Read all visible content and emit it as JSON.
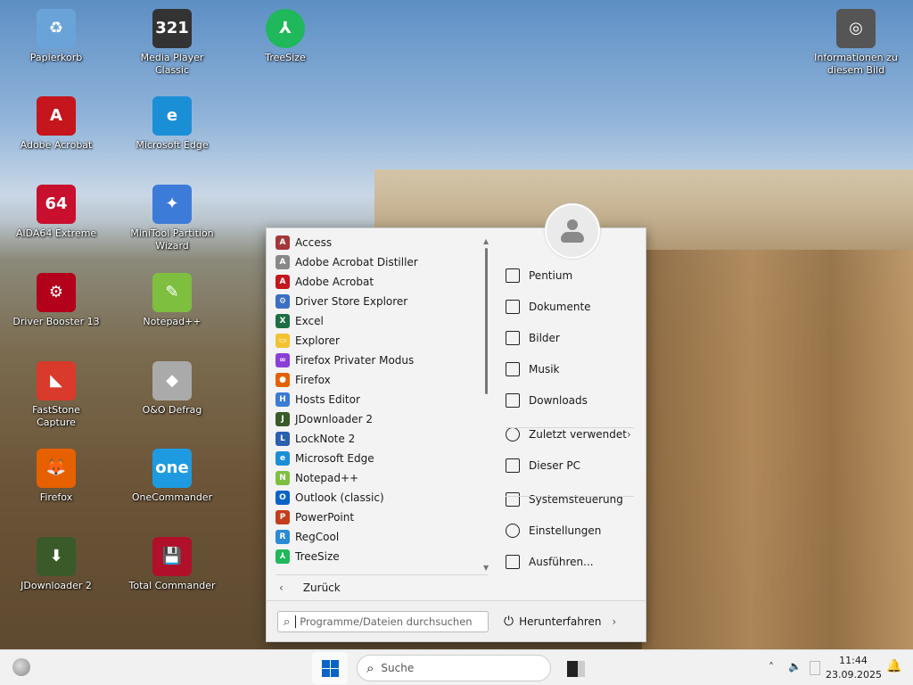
{
  "desktop": {
    "icons": [
      {
        "label": "Papierkorb",
        "glyph": "♻",
        "color": "#6aa3d8"
      },
      {
        "label": "Media Player Classic",
        "glyph": "321",
        "color": "#333"
      },
      {
        "label": "TreeSize",
        "glyph": "⅄",
        "color": "#1fb85a"
      },
      {
        "label": "Adobe Acrobat",
        "glyph": "A",
        "color": "#c4161c"
      },
      {
        "label": "Microsoft Edge",
        "glyph": "e",
        "color": "#1a8fd6"
      },
      {
        "label": "AIDA64 Extreme",
        "glyph": "64",
        "color": "#c8102e"
      },
      {
        "label": "MiniTool Partition Wizard",
        "glyph": "✦",
        "color": "#3d7bd9"
      },
      {
        "label": "Driver Booster 13",
        "glyph": "⚙",
        "color": "#b3001b"
      },
      {
        "label": "Notepad++",
        "glyph": "✎",
        "color": "#7fbf3f"
      },
      {
        "label": "FastStone Capture",
        "glyph": "◣",
        "color": "#d93a2b"
      },
      {
        "label": "O&O Defrag",
        "glyph": "◆",
        "color": "#aaa"
      },
      {
        "label": "Firefox",
        "glyph": "🦊",
        "color": "#e66000"
      },
      {
        "label": "OneCommander",
        "glyph": "one",
        "color": "#1e9be0"
      },
      {
        "label": "JDownloader 2",
        "glyph": "⬇",
        "color": "#3a5a2a"
      },
      {
        "label": "Total Commander",
        "glyph": "💾",
        "color": "#b0102a"
      },
      {
        "label": "Informationen zu diesem Bild",
        "glyph": "◎",
        "color": "#555"
      }
    ]
  },
  "start": {
    "apps": [
      {
        "label": "Access",
        "glyph": "A",
        "color": "#a4373a"
      },
      {
        "label": "Adobe Acrobat Distiller",
        "glyph": "A",
        "color": "#888"
      },
      {
        "label": "Adobe Acrobat",
        "glyph": "A",
        "color": "#c4161c"
      },
      {
        "label": "Driver Store Explorer",
        "glyph": "⚙",
        "color": "#3b6fc4"
      },
      {
        "label": "Excel",
        "glyph": "X",
        "color": "#1d6f42"
      },
      {
        "label": "Explorer",
        "glyph": "▭",
        "color": "#f2c230"
      },
      {
        "label": "Firefox Privater Modus",
        "glyph": "∞",
        "color": "#8b3fd9"
      },
      {
        "label": "Firefox",
        "glyph": "●",
        "color": "#e66000"
      },
      {
        "label": "Hosts Editor",
        "glyph": "H",
        "color": "#3a7bd5"
      },
      {
        "label": "JDownloader 2",
        "glyph": "J",
        "color": "#3a5a2a"
      },
      {
        "label": "LockNote 2",
        "glyph": "L",
        "color": "#2b5fb0"
      },
      {
        "label": "Microsoft Edge",
        "glyph": "e",
        "color": "#1a8fd6"
      },
      {
        "label": "Notepad++",
        "glyph": "N",
        "color": "#7fbf3f"
      },
      {
        "label": "Outlook (classic)",
        "glyph": "O",
        "color": "#0a64c8"
      },
      {
        "label": "PowerPoint",
        "glyph": "P",
        "color": "#c43e1c"
      },
      {
        "label": "RegCool",
        "glyph": "R",
        "color": "#2a8ad4"
      },
      {
        "label": "TreeSize",
        "glyph": "⅄",
        "color": "#1fb85a"
      }
    ],
    "back_label": "Zurück",
    "search_placeholder": "Programme/Dateien durchsuchen",
    "places": [
      {
        "label": "Pentium",
        "icon": "user-folder-icon"
      },
      {
        "label": "Dokumente",
        "icon": "document-icon"
      },
      {
        "label": "Bilder",
        "icon": "picture-icon"
      },
      {
        "label": "Musik",
        "icon": "music-icon"
      },
      {
        "label": "Downloads",
        "icon": "download-icon"
      },
      {
        "label": "Zuletzt verwendet",
        "icon": "clock-icon"
      },
      {
        "label": "Dieser PC",
        "icon": "computer-icon"
      },
      {
        "label": "Systemsteuerung",
        "icon": "control-panel-icon"
      },
      {
        "label": "Einstellungen",
        "icon": "gear-icon"
      },
      {
        "label": "Ausführen...",
        "icon": "run-icon"
      }
    ],
    "shutdown_label": "Herunterfahren"
  },
  "taskbar": {
    "search_label": "Suche",
    "time": "11:44",
    "date": "23.09.2025",
    "accent": "#0a64c8"
  }
}
